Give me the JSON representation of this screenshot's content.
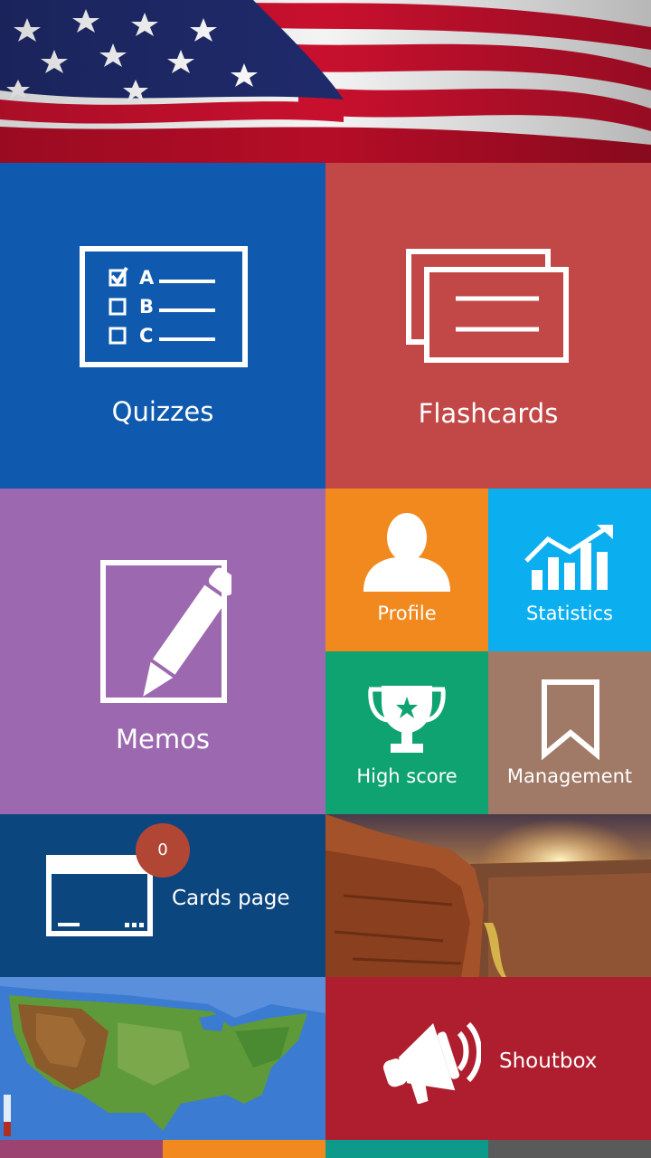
{
  "colors": {
    "quizzes": "#0F5AAE",
    "flashcards": "#C24747",
    "memos": "#9C69B1",
    "profile": "#F2891E",
    "statistics": "#0BAEEF",
    "high_score": "#0FA371",
    "management": "#A07A67",
    "cards_page": "#0B467F",
    "shoutbox": "#AE1E2E",
    "badge": "#B24634",
    "strip": [
      "#9C4371",
      "#F2891E",
      "#0E9A8B",
      "#5A5A5A"
    ]
  },
  "tiles": {
    "quizzes": {
      "label": "Quizzes",
      "icon": "checklist-icon",
      "options": [
        "A",
        "B",
        "C"
      ]
    },
    "flashcards": {
      "label": "Flashcards",
      "icon": "flashcards-icon"
    },
    "memos": {
      "label": "Memos",
      "icon": "pencil-icon"
    },
    "profile": {
      "label": "Profile",
      "icon": "person-icon"
    },
    "statistics": {
      "label": "Statistics",
      "icon": "bar-chart-icon"
    },
    "high_score": {
      "label": "High score",
      "icon": "trophy-icon"
    },
    "management": {
      "label": "Management",
      "icon": "bookmark-icon"
    },
    "cards_page": {
      "label": "Cards page",
      "icon": "card-window-icon",
      "badge": "0"
    },
    "shoutbox": {
      "label": "Shoutbox",
      "icon": "megaphone-icon"
    }
  },
  "images": {
    "banner": "american-flag-banner",
    "canyon": "canyon-sunset-photo",
    "map": "usa-terrain-map"
  }
}
